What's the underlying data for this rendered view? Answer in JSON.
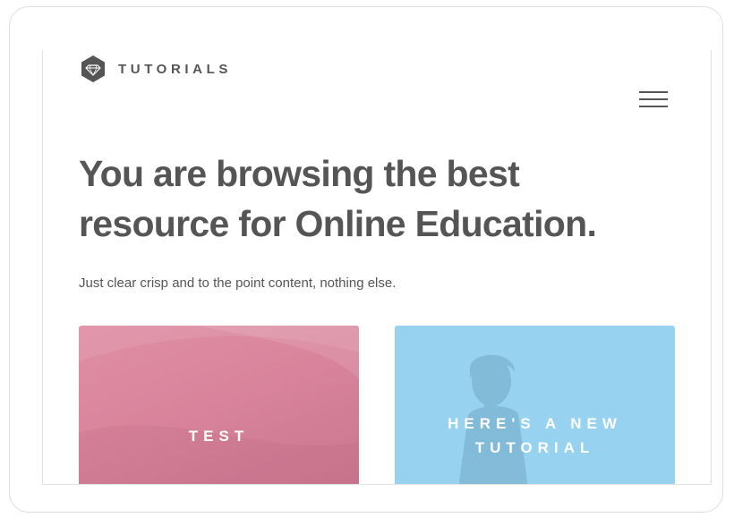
{
  "brand": {
    "name": "TUTORIALS",
    "icon": "diamond-icon"
  },
  "header": {
    "menu_icon": "hamburger-menu-icon"
  },
  "hero": {
    "title": "You are browsing the best resource for Online Education.",
    "subtitle": "Just clear crisp and to the point content, nothing else."
  },
  "cards": [
    {
      "title": "TEST",
      "color": "#d9849c"
    },
    {
      "title": "HERE'S A NEW TUTORIAL",
      "color": "#97d3f1"
    }
  ],
  "colors": {
    "text": "#555555",
    "accent_pink": "#d9849c",
    "accent_blue": "#97d3f1"
  }
}
